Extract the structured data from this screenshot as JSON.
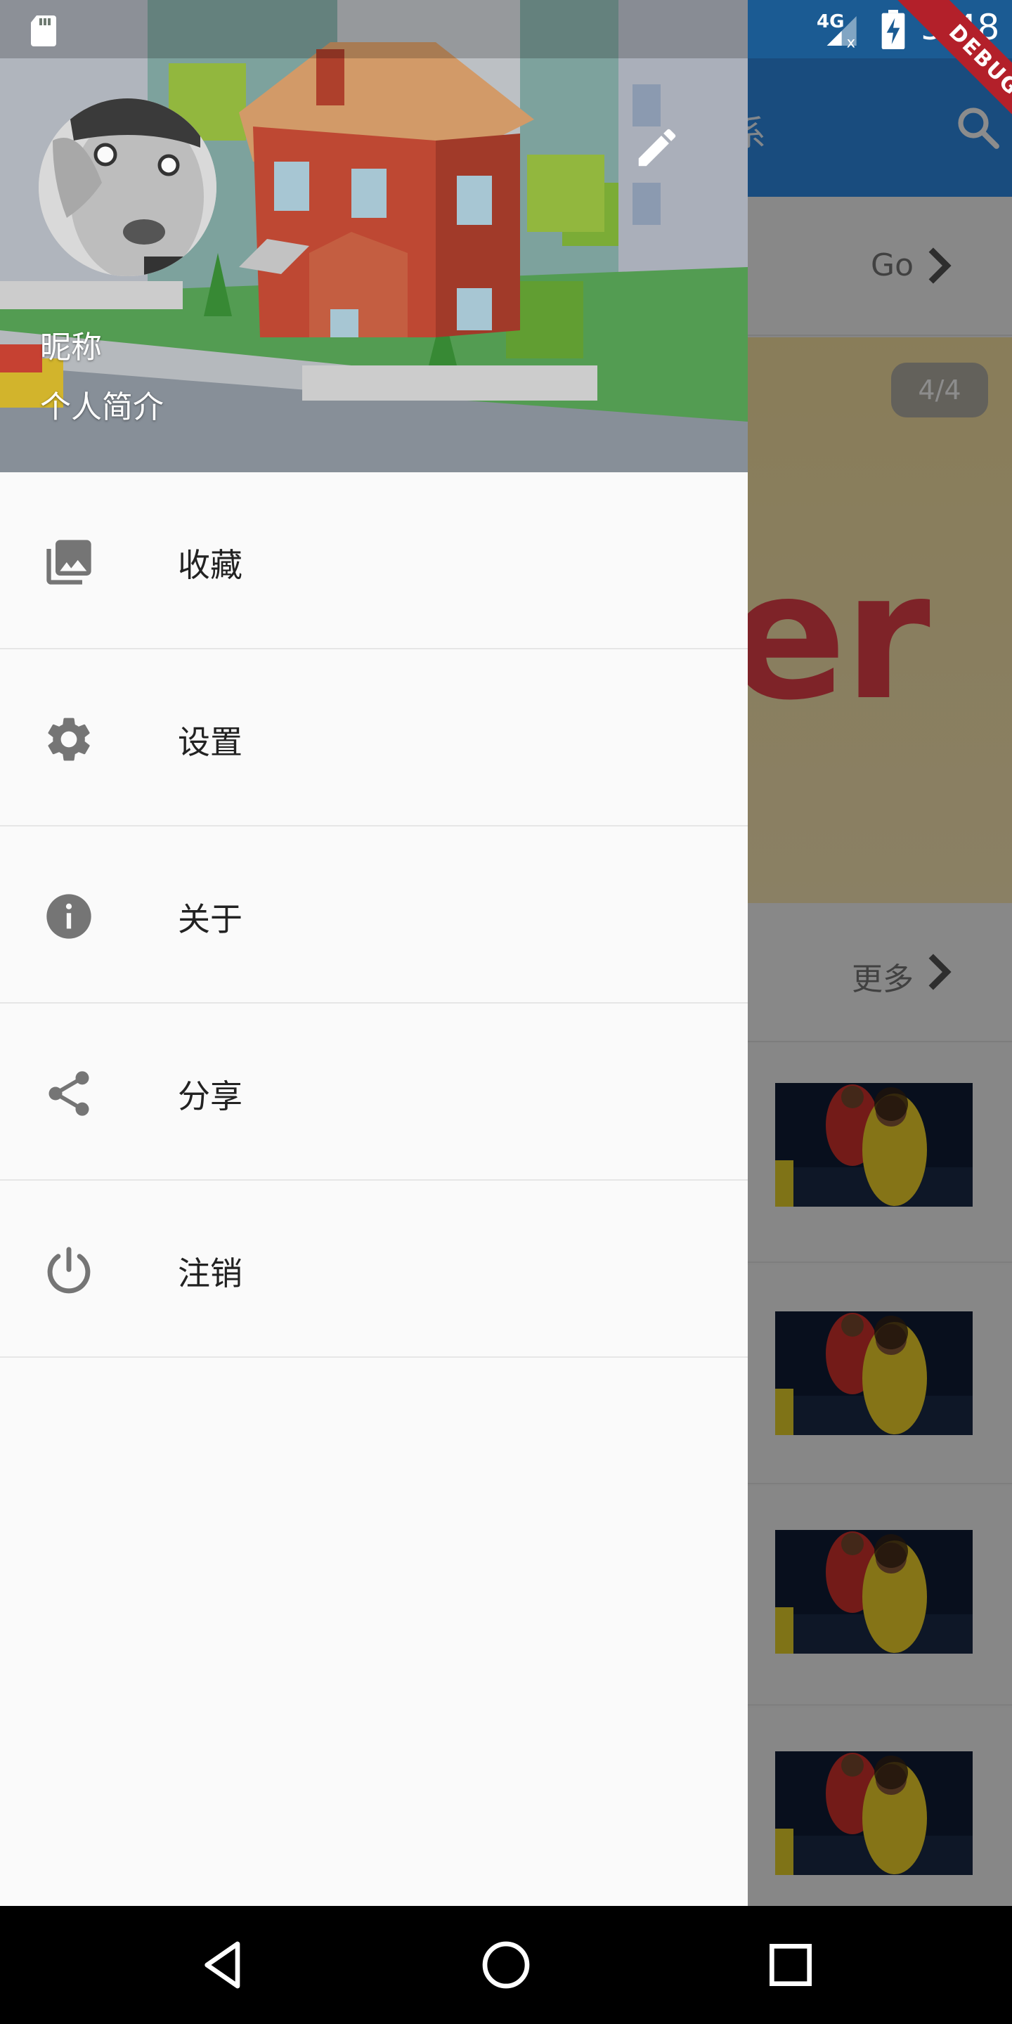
{
  "status_bar": {
    "network": "4G",
    "time": "5:48",
    "debug_label": "DEBUG",
    "icons": [
      "sd-card-icon",
      "signal-icon",
      "battery-charging-icon"
    ]
  },
  "app": {
    "title_partial": "系",
    "section1_link": "Go",
    "banner_counter": "4/4",
    "banner_text": "er",
    "section2_link": "更多",
    "news_count": 4,
    "colors": {
      "appbar": "#2e8be6",
      "banner": "#fbe6a8",
      "banner_text": "#e5414a"
    }
  },
  "drawer": {
    "nickname": "昵称",
    "bio": "个人简介",
    "menu": [
      {
        "label": "收藏",
        "icon": "photo-library-icon"
      },
      {
        "label": "设置",
        "icon": "settings-gear-icon"
      },
      {
        "label": "关于",
        "icon": "info-icon"
      },
      {
        "label": "分享",
        "icon": "share-icon"
      },
      {
        "label": "注销",
        "icon": "power-icon"
      }
    ]
  },
  "nav_bar": {
    "buttons": [
      "back-triangle-icon",
      "home-circle-icon",
      "recents-square-icon"
    ]
  }
}
